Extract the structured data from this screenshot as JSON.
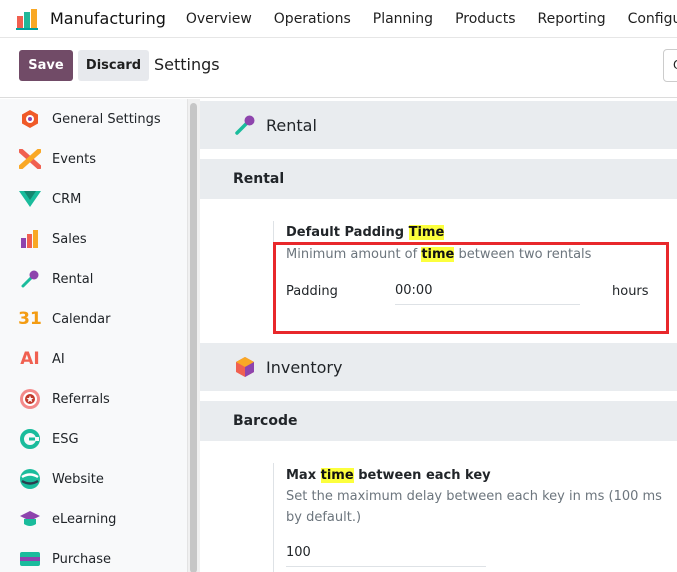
{
  "navbar": {
    "app_name": "Manufacturing",
    "menu": [
      "Overview",
      "Operations",
      "Planning",
      "Products",
      "Reporting",
      "Configuration"
    ]
  },
  "control_panel": {
    "save_label": "Save",
    "discard_label": "Discard",
    "title": "Settings",
    "search_partial": "Q"
  },
  "sidebar": {
    "items": [
      {
        "label": "General Settings",
        "icon": "general-settings-icon"
      },
      {
        "label": "Events",
        "icon": "events-icon"
      },
      {
        "label": "CRM",
        "icon": "crm-icon"
      },
      {
        "label": "Sales",
        "icon": "sales-icon"
      },
      {
        "label": "Rental",
        "icon": "rental-icon"
      },
      {
        "label": "Calendar",
        "icon": "calendar-icon"
      },
      {
        "label": "AI",
        "icon": "ai-icon"
      },
      {
        "label": "Referrals",
        "icon": "referrals-icon"
      },
      {
        "label": "ESG",
        "icon": "esg-icon"
      },
      {
        "label": "Website",
        "icon": "website-icon"
      },
      {
        "label": "eLearning",
        "icon": "elearning-icon"
      },
      {
        "label": "Purchase",
        "icon": "purchase-icon"
      }
    ],
    "calendar_icon_text": "31",
    "ai_icon_text": "AI"
  },
  "main": {
    "rental": {
      "app_title": "Rental",
      "section_title": "Rental",
      "setting_title_pre": "Default Padding ",
      "setting_title_hl": "Time",
      "desc_pre": "Minimum amount of ",
      "desc_hl": "time",
      "desc_post": " between two rentals",
      "field_label": "Padding",
      "field_value": "00:00",
      "unit": "hours"
    },
    "inventory": {
      "app_title": "Inventory",
      "section_title": "Barcode",
      "setting_title_pre": "Max ",
      "setting_title_hl": "time",
      "setting_title_post": " between each key",
      "desc": "Set the maximum delay between each key in ms (100 ms by default.)",
      "field_value": "100"
    }
  },
  "colors": {
    "primary": "#714b67",
    "highlight": "#fcff3d",
    "annotation_box": "#e8282b"
  }
}
